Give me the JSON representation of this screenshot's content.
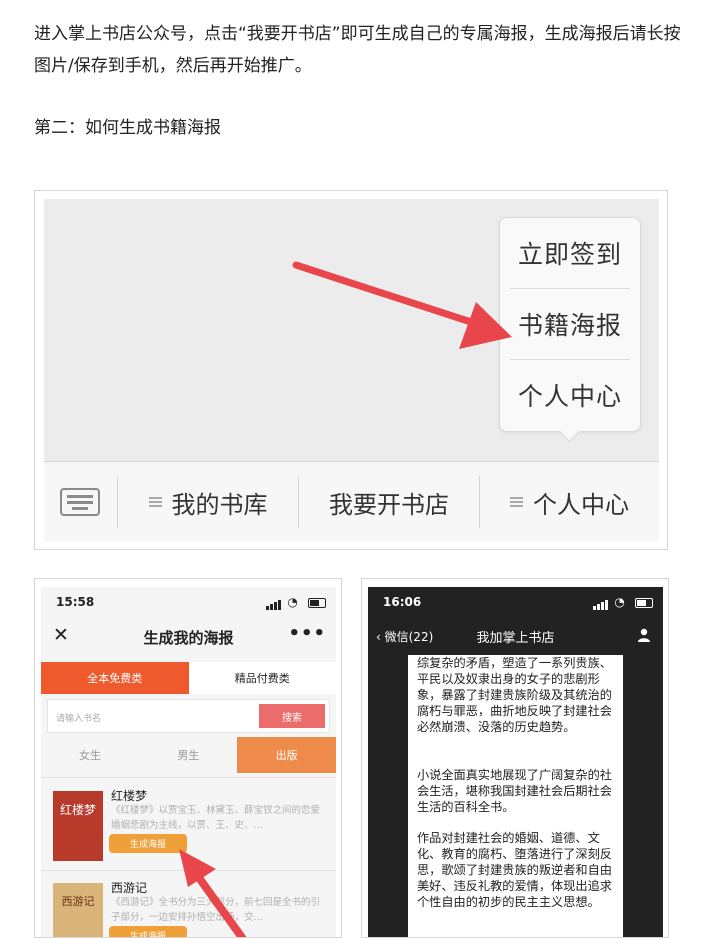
{
  "paragraph1": "进入掌上书店公众号，点击“我要开书店”即可生成自己的专属海报，生成海报后请长按图片/保存到手机，然后再开始推广。",
  "paragraph2": "第二：如何生成书籍海报",
  "wechat_menu": {
    "popup_items": [
      "立即签到",
      "书籍海报",
      "个人中心"
    ],
    "bar_items": [
      "我的书库",
      "我要开书店",
      "个人中心"
    ],
    "keyboard_icon": "keyboard-icon",
    "arrow_color": "#e8464b"
  },
  "poster_screen": {
    "time": "15:58",
    "title": "生成我的海报",
    "close": "✕",
    "more": "•••",
    "tabs": [
      "全本免费类",
      "精品付费类"
    ],
    "search_placeholder": "请输入书名",
    "search_button": "搜索",
    "categories": [
      "女生",
      "男生",
      "出版"
    ],
    "books": [
      {
        "cover": "红楼梦",
        "title": "红楼梦",
        "desc": "《红楼梦》以贾宝玉、林黛玉、薛宝钗之间的恋爱婚姻悲剧为主线，以贾、王、史、…",
        "button": "生成海报"
      },
      {
        "cover": "西游记",
        "title": "西游记",
        "desc": "《西游记》全书分为三大部分，前七回是全书的引子部分，一边安排孙悟空出场，交…",
        "button": "生成海报"
      }
    ],
    "accent": "#ee5a2e"
  },
  "article_screen": {
    "time": "16:06",
    "back": "微信(22)",
    "title": "我加掌上书店",
    "p1": "综复杂的矛盾，塑造了一系列贵族、平民以及奴隶出身的女子的悲剧形象，暴露了封建贵族阶级及其统治的腐朽与罪恶，曲折地反映了封建社会必然崩溃、没落的历史趋势。",
    "p2": "小说全面真实地展现了广阔复杂的社会生活，堪称我国封建社会后期社会生活的百科全书。",
    "p3": "作品对封建社会的婚姻、道德、文化、教育的腐朽、堕落进行了深刻反思，歌颂了封建贵族的叛逆者和自由美好、违反礼教的爱情，体现出追求个性自由的初步的民主主义思想。"
  }
}
